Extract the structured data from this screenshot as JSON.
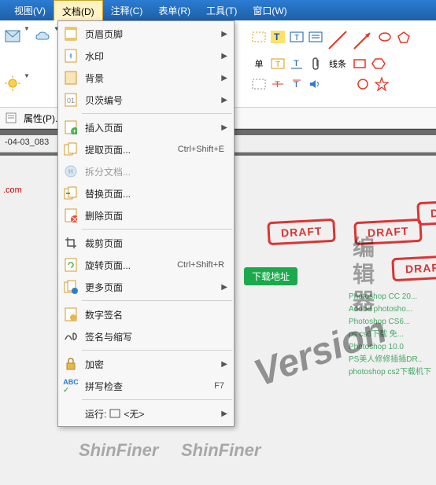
{
  "menubar": {
    "items": [
      {
        "label": "视图(V)"
      },
      {
        "label": "文档(D)",
        "active": true
      },
      {
        "label": "注释(C)"
      },
      {
        "label": "表单(R)"
      },
      {
        "label": "工具(T)"
      },
      {
        "label": "窗口(W)"
      }
    ]
  },
  "dropdown": {
    "items": [
      {
        "label": "页眉页脚",
        "icon": "header-footer",
        "arrow": true
      },
      {
        "label": "水印",
        "icon": "watermark",
        "arrow": true
      },
      {
        "label": "背景",
        "icon": "background",
        "arrow": true
      },
      {
        "label": "贝茨编号",
        "icon": "bates",
        "arrow": true
      },
      {
        "sep": true
      },
      {
        "label": "插入页面",
        "icon": "insert-page",
        "arrow": true
      },
      {
        "label": "提取页面...",
        "icon": "extract-page",
        "shortcut": "Ctrl+Shift+E"
      },
      {
        "label": "拆分文档...",
        "icon": "split-doc",
        "disabled": true
      },
      {
        "label": "替换页面...",
        "icon": "replace-page"
      },
      {
        "label": "删除页面",
        "icon": "delete-page"
      },
      {
        "sep": true
      },
      {
        "label": "裁剪页面",
        "icon": "crop-page"
      },
      {
        "label": "旋转页面...",
        "icon": "rotate-page",
        "shortcut": "Ctrl+Shift+R"
      },
      {
        "label": "更多页面",
        "icon": "more-pages",
        "arrow": true
      },
      {
        "sep": true
      },
      {
        "label": "数字签名",
        "icon": "digital-sign"
      },
      {
        "label": "签名与缩写",
        "icon": "sign-initials"
      },
      {
        "sep": true
      },
      {
        "label": "加密",
        "icon": "encrypt",
        "arrow": true
      },
      {
        "label": "拼写检查",
        "icon": "spellcheck",
        "shortcut": "F7"
      },
      {
        "sep": true
      }
    ],
    "run_label": "运行:",
    "run_value": "<无>"
  },
  "secondbar": {
    "prop": "属性(P)...",
    "tabname": "-04-03_083"
  },
  "toolbar_right": {
    "line_label": "线条"
  },
  "content": {
    "red_link": ".com",
    "draft": "DRAFT",
    "download": "下载地址",
    "side_items": [
      "Photoshop CC 20...",
      "Adobe photosho...",
      "Photoshop CS6...",
      "ps cs6下载 免...",
      "Photoshop 10.0",
      "PS美人修修插插DR..",
      "photoshop cs2下载机下"
    ],
    "watermark_version": "Version",
    "watermark_brand": "ShinFiner",
    "cn_watermark": "编辑器"
  }
}
